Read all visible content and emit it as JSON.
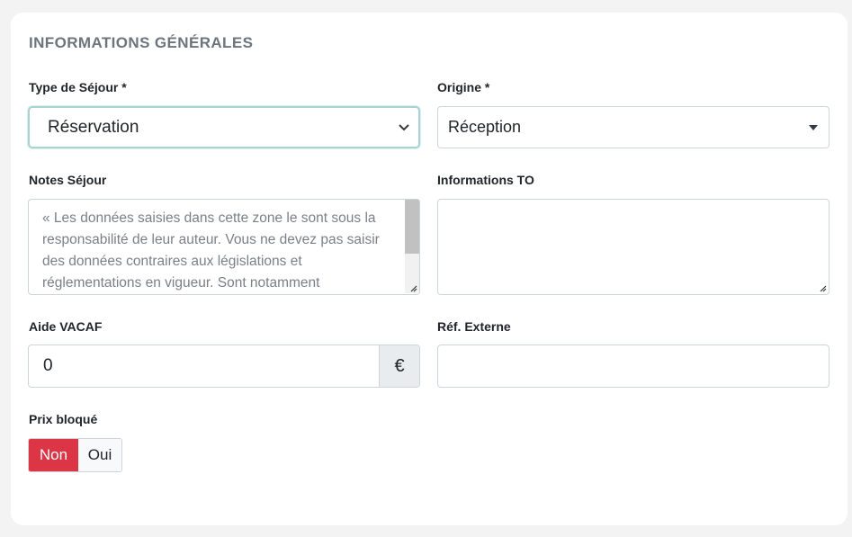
{
  "section": {
    "title": "INFORMATIONS GÉNÉRALES"
  },
  "type_sejour": {
    "label": "Type de Séjour *",
    "value": "Réservation"
  },
  "origine": {
    "label": "Origine *",
    "value": "Réception"
  },
  "notes_sejour": {
    "label": "Notes Séjour",
    "placeholder": "« Les données saisies dans cette zone le sont sous la responsabilité de leur auteur. Vous ne devez pas saisir des données contraires aux législations et réglementations en vigueur. Sont notamment"
  },
  "informations_to": {
    "label": "Informations TO",
    "value": ""
  },
  "aide_vacaf": {
    "label": "Aide VACAF",
    "value": "0",
    "addon": "€"
  },
  "ref_externe": {
    "label": "Réf. Externe",
    "value": ""
  },
  "prix_bloque": {
    "label": "Prix bloqué",
    "options": [
      {
        "label": "Non",
        "selected": true,
        "color": "#dc3545"
      },
      {
        "label": "Oui",
        "selected": false
      }
    ]
  },
  "icons": {
    "type_sejour_toggle": "chevron-down-icon",
    "origine_toggle": "caret-down-icon",
    "textarea_grip": "resize-grip-icon"
  }
}
